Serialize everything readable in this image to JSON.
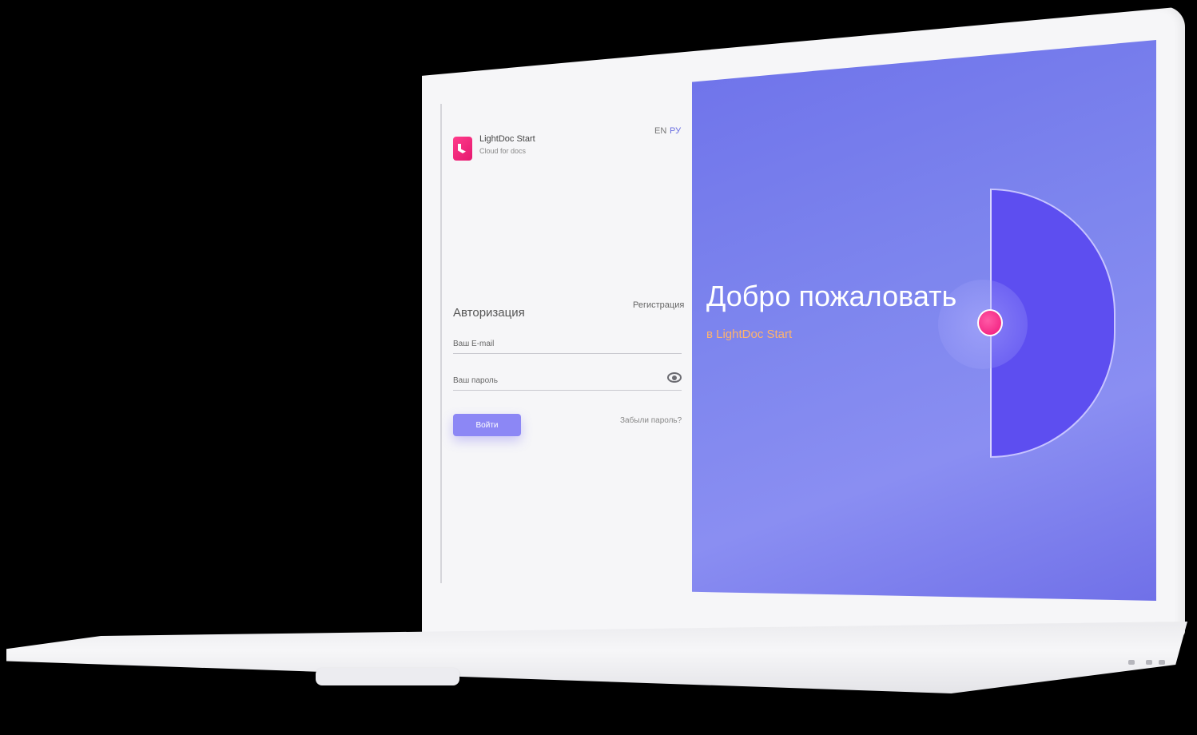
{
  "brand": {
    "name": "LightDoc Start",
    "tagline": "Cloud for docs"
  },
  "languages": {
    "en": "EN",
    "ru": "РУ",
    "active": "РУ"
  },
  "auth": {
    "title": "Авторизация",
    "register_link": "Регистрация",
    "email_placeholder": "Ваш E-mail",
    "password_placeholder": "Ваш пароль",
    "login_button": "Войти",
    "forgot_link": "Забыли пароль?"
  },
  "welcome": {
    "title": "Добро пожаловать",
    "subtitle": "в LightDoc Start"
  },
  "colors": {
    "accent": "#8c87f5",
    "brand_pink": "#f0167a",
    "panel_bg": "#7d82ee",
    "subtitle": "#ffb36b"
  }
}
